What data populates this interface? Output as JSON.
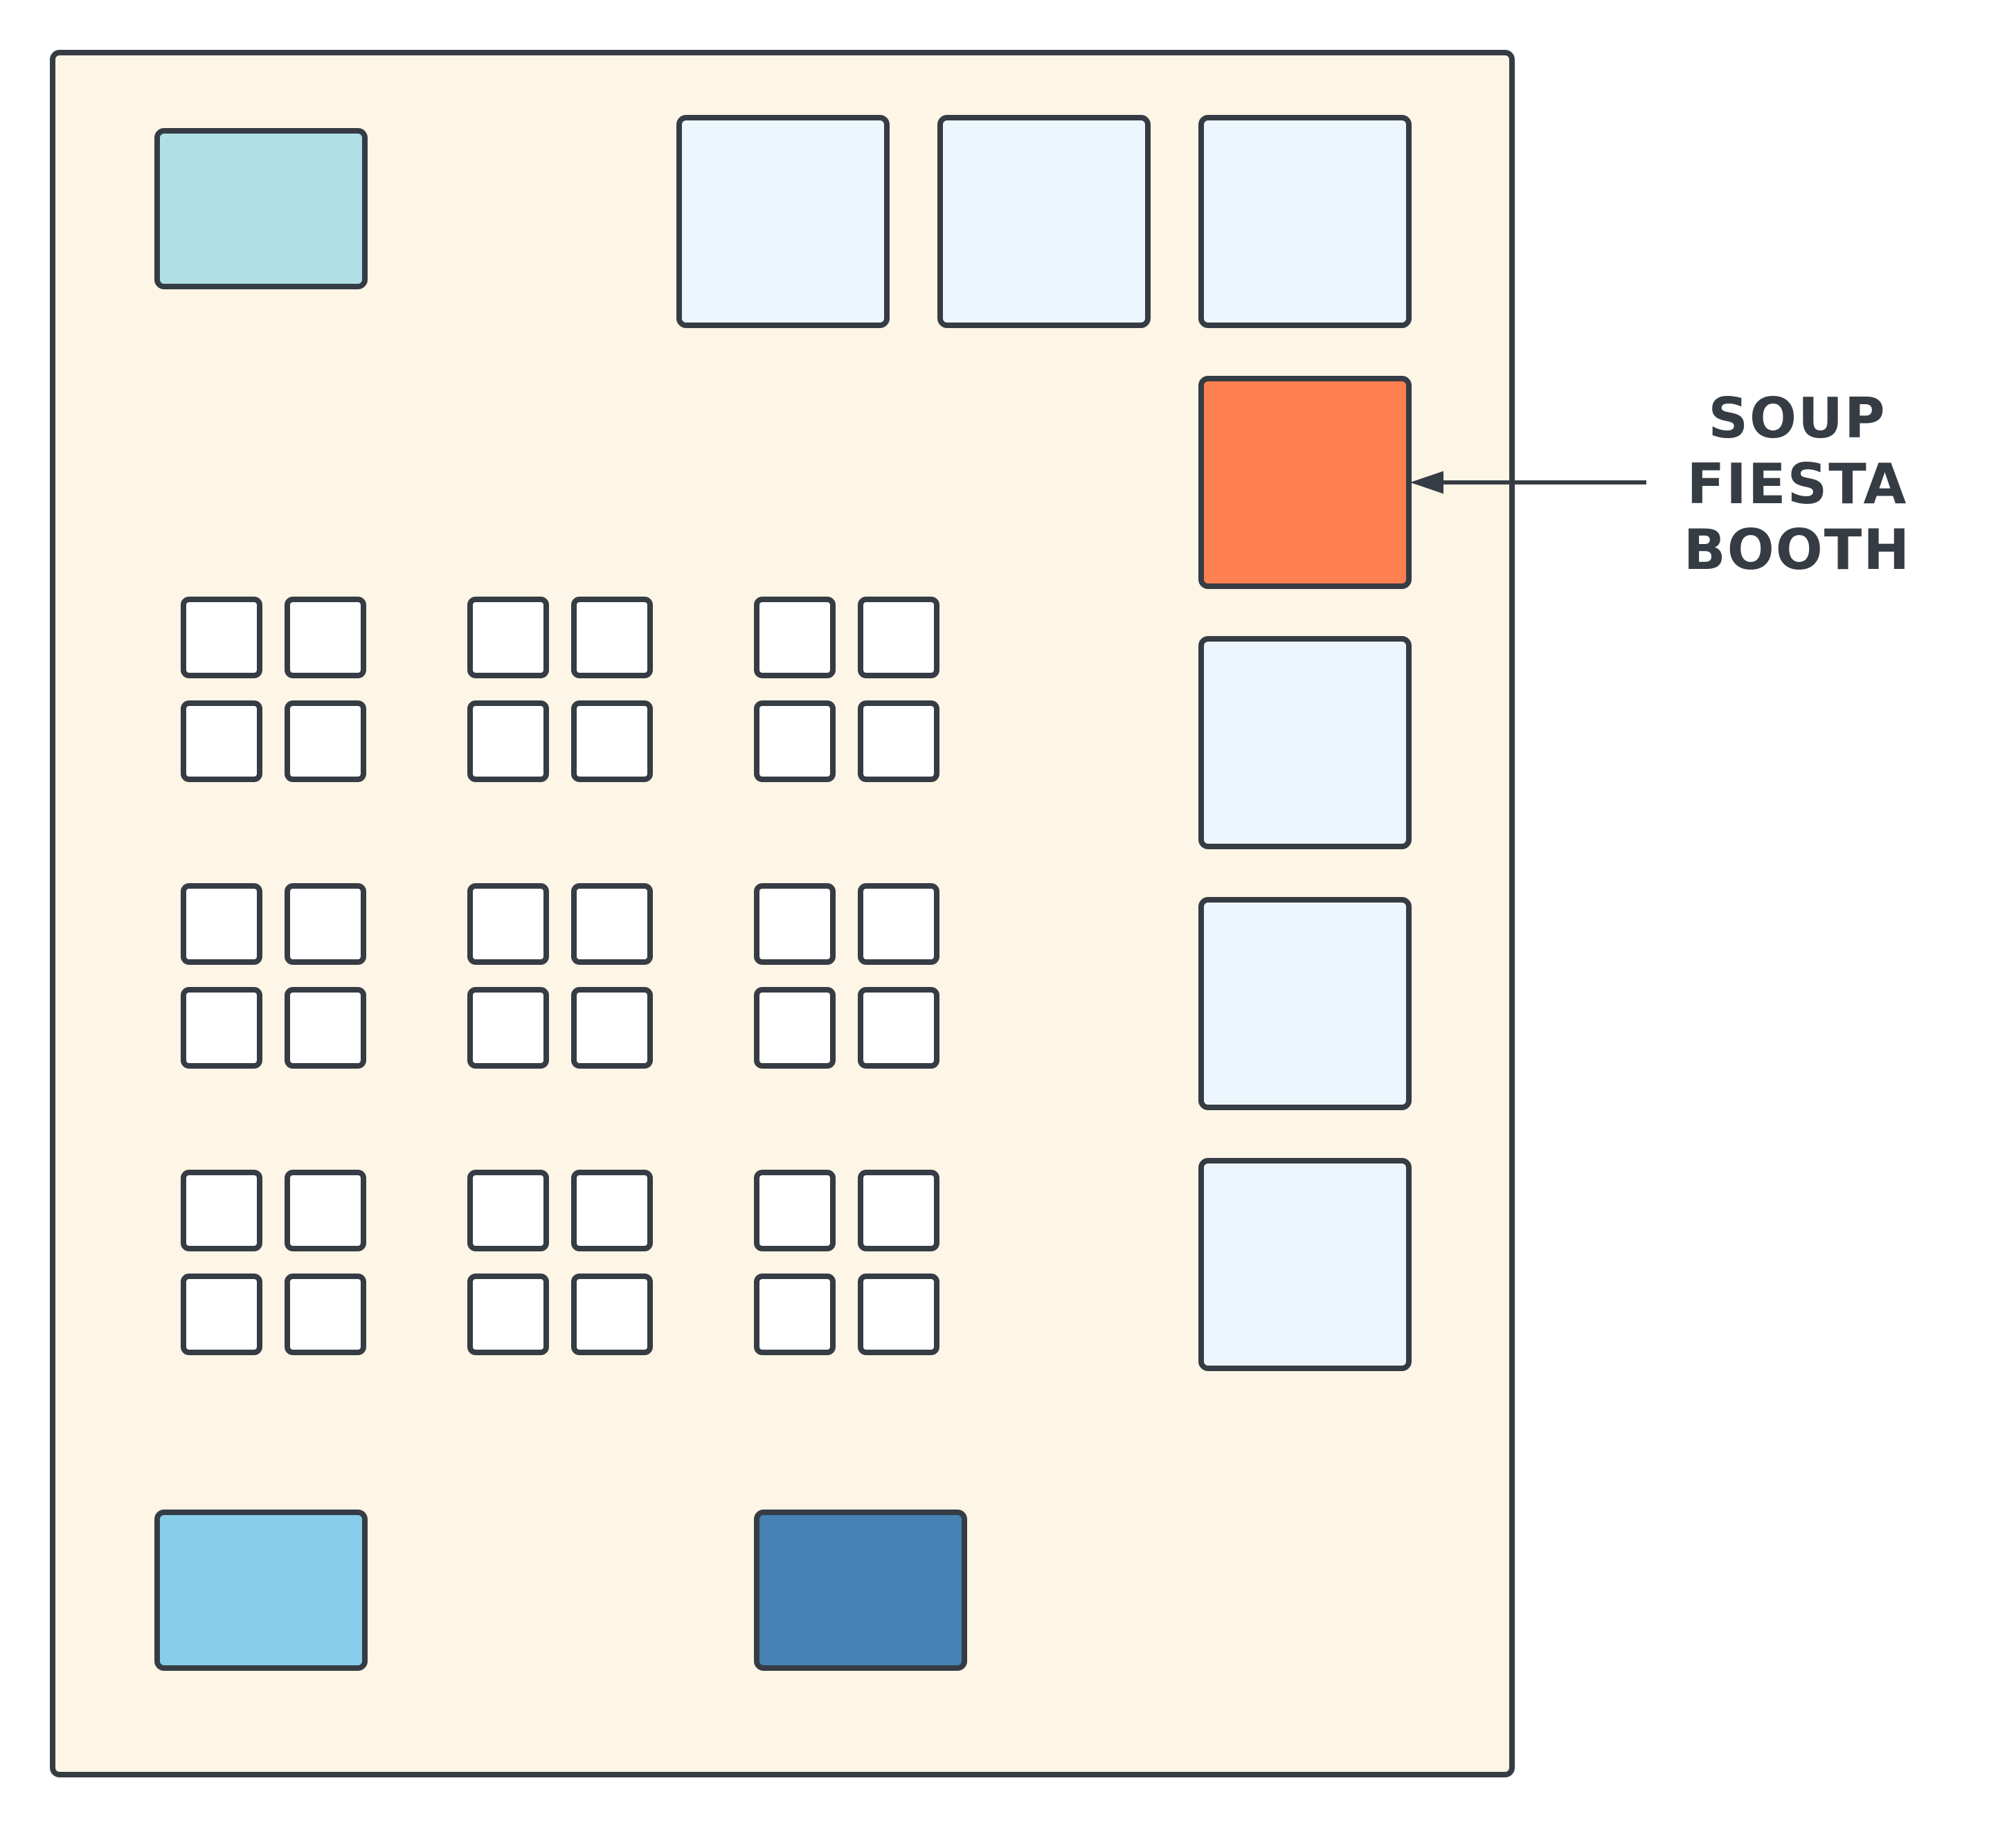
{
  "diagram": {
    "colors": {
      "outline": "#363c44",
      "floor": "#fdf5e6",
      "booth": "#eef6fd",
      "highlighted_booth": "#fe7f50",
      "table": "#ffffff",
      "top_left_area": "#b0dfe5",
      "bottom_left_area": "#87ceeb",
      "bottom_center_area": "#4682b4"
    },
    "annotation": {
      "lines": [
        "SOUP",
        "FIESTA",
        "BOOTH"
      ],
      "points_to": "highlighted-booth"
    }
  }
}
